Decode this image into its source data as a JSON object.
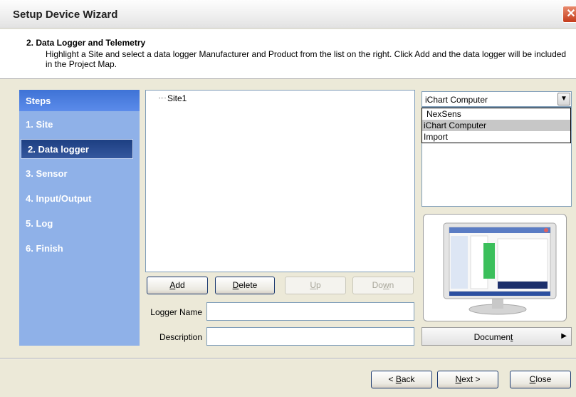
{
  "window": {
    "title": "Setup Device Wizard",
    "close_glyph": "✕"
  },
  "header": {
    "title": "2. Data Logger and Telemetry",
    "description": "Highlight a Site and select a data logger Manufacturer and Product from the list on the right. Click Add and the data logger will be included in the Project Map."
  },
  "steps": {
    "heading": "Steps",
    "items": [
      {
        "label": "1. Site"
      },
      {
        "label": "2. Data logger",
        "active": true
      },
      {
        "label": "3. Sensor"
      },
      {
        "label": "4. Input/Output"
      },
      {
        "label": "5. Log"
      },
      {
        "label": "6. Finish"
      }
    ]
  },
  "tree": {
    "items": [
      "Site1"
    ]
  },
  "buttons": {
    "add": {
      "mnemonic": "A",
      "rest": "dd"
    },
    "delete": {
      "mnemonic": "D",
      "rest": "elete"
    },
    "up": {
      "mnemonic": "U",
      "rest": "p"
    },
    "down": {
      "pre": "Do",
      "mnemonic": "w",
      "rest": "n"
    }
  },
  "form": {
    "logger_name_label": "Logger Name",
    "logger_name_value": "",
    "description_label": "Description",
    "description_value": ""
  },
  "manufacturer": {
    "selected": "iChart Computer",
    "options": [
      "NexSens",
      "iChart Computer",
      "Import"
    ],
    "highlighted_index": 1
  },
  "document_button": {
    "pre": "Documen",
    "mnemonic": "t",
    "arrow": "▶"
  },
  "footer": {
    "back": {
      "pre": "< ",
      "mnemonic": "B",
      "rest": "ack"
    },
    "next": {
      "mnemonic": "N",
      "rest": "ext >"
    },
    "close": {
      "mnemonic": "C",
      "rest": "lose"
    }
  },
  "colors": {
    "steps_panel": "#8fb1e8",
    "steps_header": "#4a7edf",
    "active_step": "#24478c"
  }
}
